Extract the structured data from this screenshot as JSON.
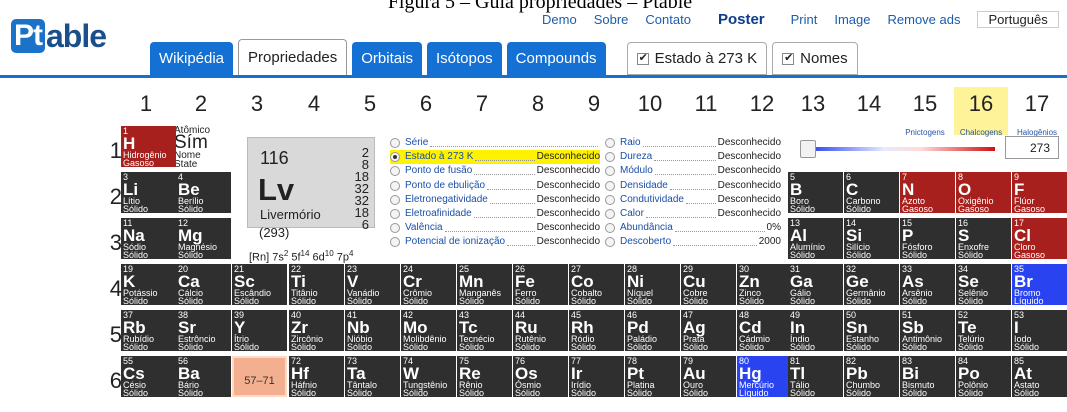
{
  "caption": "Figura 5 – Guia propriedades – Ptable",
  "logo": {
    "box": "Pt",
    "rest": "able"
  },
  "toplinks": [
    "Demo",
    "Sobre",
    "Contato"
  ],
  "poster": "Poster",
  "toolbar_links": [
    "Print",
    "Image",
    "Remove ads"
  ],
  "language": "Português",
  "tabs": [
    "Wikipédia",
    "Propriedades",
    "Orbitais",
    "Isótopos",
    "Compounds"
  ],
  "checks": [
    "Estado à 273 K",
    "Nomes"
  ],
  "groups": [
    "1",
    "2",
    "3",
    "4",
    "5",
    "6",
    "7",
    "8",
    "9",
    "10",
    "11",
    "12",
    "13",
    "14",
    "15",
    "16",
    "17"
  ],
  "group_subs": {
    "g15": "Pnictogens",
    "g16": "Chalcogens",
    "g17": "Halogênios"
  },
  "periods": [
    "1",
    "2",
    "3",
    "4",
    "5",
    "6"
  ],
  "legend": {
    "line1": "Atômico",
    "sim": "Sím",
    "line3": "Nome",
    "line4": "State"
  },
  "selected": {
    "number": "116",
    "symbol": "Lv",
    "name": "Livermório",
    "mass": "(293)",
    "shells": [
      "2",
      "8",
      "18",
      "32",
      "32",
      "18",
      "6"
    ],
    "config_prefix": "[Rn] 7s",
    "config_s": "2",
    "config_f_text": " 5f",
    "config_f": "14",
    "config_d_text": " 6d",
    "config_d": "10",
    "config_p_text": " 7p",
    "config_p": "4"
  },
  "properties_col1": [
    {
      "label": "Série",
      "value": ""
    },
    {
      "label": "Estado à 273 K",
      "value": "Desconhecido",
      "checked": true
    },
    {
      "label": "Ponto de fusão",
      "value": "Desconhecido"
    },
    {
      "label": "Ponto de ebulição",
      "value": "Desconhecido"
    },
    {
      "label": "Eletronegatividade",
      "value": "Desconhecido"
    },
    {
      "label": "Eletroafinidade",
      "value": "Desconhecido"
    },
    {
      "label": "Valência",
      "value": "Desconhecido"
    },
    {
      "label": "Potencial de ionização",
      "value": "Desconhecido"
    }
  ],
  "properties_col2": [
    {
      "label": "Raio",
      "value": "Desconhecido"
    },
    {
      "label": "Dureza",
      "value": "Desconhecido"
    },
    {
      "label": "Módulo",
      "value": "Desconhecido"
    },
    {
      "label": "Densidade",
      "value": "Desconhecido"
    },
    {
      "label": "Condutividade",
      "value": "Desconhecido"
    },
    {
      "label": "Calor",
      "value": "Desconhecido"
    },
    {
      "label": "Abundância",
      "value": "0%"
    },
    {
      "label": "Descoberto",
      "value": "2000"
    }
  ],
  "temperature": "273",
  "elements": [
    {
      "n": "1",
      "s": "H",
      "nm": "Hidrogênio",
      "st": "Gasoso",
      "c": "red",
      "g": 1,
      "p": 1
    },
    {
      "n": "3",
      "s": "Li",
      "nm": "Lítio",
      "st": "Sólido",
      "c": "dark",
      "g": 1,
      "p": 2
    },
    {
      "n": "4",
      "s": "Be",
      "nm": "Berílio",
      "st": "Sólido",
      "c": "dark",
      "g": 2,
      "p": 2
    },
    {
      "n": "5",
      "s": "B",
      "nm": "Boro",
      "st": "Sólido",
      "c": "dark",
      "g": 13,
      "p": 2
    },
    {
      "n": "6",
      "s": "C",
      "nm": "Carbono",
      "st": "Sólido",
      "c": "dark",
      "g": 14,
      "p": 2
    },
    {
      "n": "7",
      "s": "N",
      "nm": "Azoto",
      "st": "Gasoso",
      "c": "red",
      "g": 15,
      "p": 2
    },
    {
      "n": "8",
      "s": "O",
      "nm": "Oxigênio",
      "st": "Gasoso",
      "c": "red",
      "g": 16,
      "p": 2
    },
    {
      "n": "9",
      "s": "F",
      "nm": "Flúor",
      "st": "Gasoso",
      "c": "red",
      "g": 17,
      "p": 2
    },
    {
      "n": "11",
      "s": "Na",
      "nm": "Sódio",
      "st": "Sólido",
      "c": "dark",
      "g": 1,
      "p": 3
    },
    {
      "n": "12",
      "s": "Mg",
      "nm": "Magnésio",
      "st": "Sólido",
      "c": "dark",
      "g": 2,
      "p": 3
    },
    {
      "n": "13",
      "s": "Al",
      "nm": "Alumínio",
      "st": "Sólido",
      "c": "dark",
      "g": 13,
      "p": 3
    },
    {
      "n": "14",
      "s": "Si",
      "nm": "Silício",
      "st": "Sólido",
      "c": "dark",
      "g": 14,
      "p": 3
    },
    {
      "n": "15",
      "s": "P",
      "nm": "Fósforo",
      "st": "Sólido",
      "c": "dark",
      "g": 15,
      "p": 3
    },
    {
      "n": "16",
      "s": "S",
      "nm": "Enxofre",
      "st": "Sólido",
      "c": "dark",
      "g": 16,
      "p": 3
    },
    {
      "n": "17",
      "s": "Cl",
      "nm": "Cloro",
      "st": "Gasoso",
      "c": "red",
      "g": 17,
      "p": 3
    },
    {
      "n": "19",
      "s": "K",
      "nm": "Potássio",
      "st": "Sólido",
      "c": "dark",
      "g": 1,
      "p": 4
    },
    {
      "n": "20",
      "s": "Ca",
      "nm": "Cálcio",
      "st": "Sólido",
      "c": "dark",
      "g": 2,
      "p": 4
    },
    {
      "n": "21",
      "s": "Sc",
      "nm": "Escândio",
      "st": "Sólido",
      "c": "dark",
      "g": 3,
      "p": 4
    },
    {
      "n": "22",
      "s": "Ti",
      "nm": "Titânio",
      "st": "Sólido",
      "c": "dark",
      "g": 4,
      "p": 4
    },
    {
      "n": "23",
      "s": "V",
      "nm": "Vanádio",
      "st": "Sólido",
      "c": "dark",
      "g": 5,
      "p": 4
    },
    {
      "n": "24",
      "s": "Cr",
      "nm": "Crômio",
      "st": "Sólido",
      "c": "dark",
      "g": 6,
      "p": 4
    },
    {
      "n": "25",
      "s": "Mn",
      "nm": "Manganês",
      "st": "Sólido",
      "c": "dark",
      "g": 7,
      "p": 4
    },
    {
      "n": "26",
      "s": "Fe",
      "nm": "Ferro",
      "st": "Sólido",
      "c": "dark",
      "g": 8,
      "p": 4
    },
    {
      "n": "27",
      "s": "Co",
      "nm": "Cobalto",
      "st": "Sólido",
      "c": "dark",
      "g": 9,
      "p": 4
    },
    {
      "n": "28",
      "s": "Ni",
      "nm": "Níquel",
      "st": "Sólido",
      "c": "dark",
      "g": 10,
      "p": 4
    },
    {
      "n": "29",
      "s": "Cu",
      "nm": "Cobre",
      "st": "Sólido",
      "c": "dark",
      "g": 11,
      "p": 4
    },
    {
      "n": "30",
      "s": "Zn",
      "nm": "Zinco",
      "st": "Sólido",
      "c": "dark",
      "g": 12,
      "p": 4
    },
    {
      "n": "31",
      "s": "Ga",
      "nm": "Gálio",
      "st": "Sólido",
      "c": "dark",
      "g": 13,
      "p": 4
    },
    {
      "n": "32",
      "s": "Ge",
      "nm": "Germânio",
      "st": "Sólido",
      "c": "dark",
      "g": 14,
      "p": 4
    },
    {
      "n": "33",
      "s": "As",
      "nm": "Arsênio",
      "st": "Sólido",
      "c": "dark",
      "g": 15,
      "p": 4
    },
    {
      "n": "34",
      "s": "Se",
      "nm": "Selênio",
      "st": "Sólido",
      "c": "dark",
      "g": 16,
      "p": 4
    },
    {
      "n": "35",
      "s": "Br",
      "nm": "Bromo",
      "st": "Líquido",
      "c": "blue",
      "g": 17,
      "p": 4
    },
    {
      "n": "37",
      "s": "Rb",
      "nm": "Rubídio",
      "st": "Sólido",
      "c": "dark",
      "g": 1,
      "p": 5
    },
    {
      "n": "38",
      "s": "Sr",
      "nm": "Estrôncio",
      "st": "Sólido",
      "c": "dark",
      "g": 2,
      "p": 5
    },
    {
      "n": "39",
      "s": "Y",
      "nm": "Ítrio",
      "st": "Sólido",
      "c": "dark",
      "g": 3,
      "p": 5
    },
    {
      "n": "40",
      "s": "Zr",
      "nm": "Zircônio",
      "st": "Sólido",
      "c": "dark",
      "g": 4,
      "p": 5
    },
    {
      "n": "41",
      "s": "Nb",
      "nm": "Nióbio",
      "st": "Sólido",
      "c": "dark",
      "g": 5,
      "p": 5
    },
    {
      "n": "42",
      "s": "Mo",
      "nm": "Molibdênio",
      "st": "Sólido",
      "c": "dark",
      "g": 6,
      "p": 5
    },
    {
      "n": "43",
      "s": "Tc",
      "nm": "Tecnécio",
      "st": "Sólido",
      "c": "dark",
      "g": 7,
      "p": 5
    },
    {
      "n": "44",
      "s": "Ru",
      "nm": "Rutênio",
      "st": "Sólido",
      "c": "dark",
      "g": 8,
      "p": 5
    },
    {
      "n": "45",
      "s": "Rh",
      "nm": "Ródio",
      "st": "Sólido",
      "c": "dark",
      "g": 9,
      "p": 5
    },
    {
      "n": "46",
      "s": "Pd",
      "nm": "Paládio",
      "st": "Sólido",
      "c": "dark",
      "g": 10,
      "p": 5
    },
    {
      "n": "47",
      "s": "Ag",
      "nm": "Prata",
      "st": "Sólido",
      "c": "dark",
      "g": 11,
      "p": 5
    },
    {
      "n": "48",
      "s": "Cd",
      "nm": "Cádmio",
      "st": "Sólido",
      "c": "dark",
      "g": 12,
      "p": 5
    },
    {
      "n": "49",
      "s": "In",
      "nm": "Índio",
      "st": "Sólido",
      "c": "dark",
      "g": 13,
      "p": 5
    },
    {
      "n": "50",
      "s": "Sn",
      "nm": "Estanho",
      "st": "Sólido",
      "c": "dark",
      "g": 14,
      "p": 5
    },
    {
      "n": "51",
      "s": "Sb",
      "nm": "Antimônio",
      "st": "Sólido",
      "c": "dark",
      "g": 15,
      "p": 5
    },
    {
      "n": "52",
      "s": "Te",
      "nm": "Telúrio",
      "st": "Sólido",
      "c": "dark",
      "g": 16,
      "p": 5
    },
    {
      "n": "53",
      "s": "I",
      "nm": "Iodo",
      "st": "Sólido",
      "c": "dark",
      "g": 17,
      "p": 5
    },
    {
      "n": "55",
      "s": "Cs",
      "nm": "Césio",
      "st": "Sólido",
      "c": "dark",
      "g": 1,
      "p": 6
    },
    {
      "n": "56",
      "s": "Ba",
      "nm": "Bário",
      "st": "Sólido",
      "c": "dark",
      "g": 2,
      "p": 6
    },
    {
      "n": "72",
      "s": "Hf",
      "nm": "Háfnio",
      "st": "Sólido",
      "c": "dark",
      "g": 4,
      "p": 6
    },
    {
      "n": "73",
      "s": "Ta",
      "nm": "Tântalo",
      "st": "Sólido",
      "c": "dark",
      "g": 5,
      "p": 6
    },
    {
      "n": "74",
      "s": "W",
      "nm": "Tungstênio",
      "st": "Sólido",
      "c": "dark",
      "g": 6,
      "p": 6
    },
    {
      "n": "75",
      "s": "Re",
      "nm": "Rênio",
      "st": "Sólido",
      "c": "dark",
      "g": 7,
      "p": 6
    },
    {
      "n": "76",
      "s": "Os",
      "nm": "Ósmio",
      "st": "Sólido",
      "c": "dark",
      "g": 8,
      "p": 6
    },
    {
      "n": "77",
      "s": "Ir",
      "nm": "Irídio",
      "st": "Sólido",
      "c": "dark",
      "g": 9,
      "p": 6
    },
    {
      "n": "78",
      "s": "Pt",
      "nm": "Platina",
      "st": "Sólido",
      "c": "dark",
      "g": 10,
      "p": 6
    },
    {
      "n": "79",
      "s": "Au",
      "nm": "Ouro",
      "st": "Sólido",
      "c": "dark",
      "g": 11,
      "p": 6
    },
    {
      "n": "80",
      "s": "Hg",
      "nm": "Mercúrio",
      "st": "Líquido",
      "c": "blue",
      "g": 12,
      "p": 6
    },
    {
      "n": "81",
      "s": "Tl",
      "nm": "Tálio",
      "st": "Sólido",
      "c": "dark",
      "g": 13,
      "p": 6
    },
    {
      "n": "82",
      "s": "Pb",
      "nm": "Chumbo",
      "st": "Sólido",
      "c": "dark",
      "g": 14,
      "p": 6
    },
    {
      "n": "83",
      "s": "Bi",
      "nm": "Bismuto",
      "st": "Sólido",
      "c": "dark",
      "g": 15,
      "p": 6
    },
    {
      "n": "84",
      "s": "Po",
      "nm": "Polônio",
      "st": "Sólido",
      "c": "dark",
      "g": 16,
      "p": 6
    },
    {
      "n": "85",
      "s": "At",
      "nm": "Astato",
      "st": "Sólido",
      "c": "dark",
      "g": 17,
      "p": 6
    }
  ],
  "lanthanide_range": "57–71"
}
